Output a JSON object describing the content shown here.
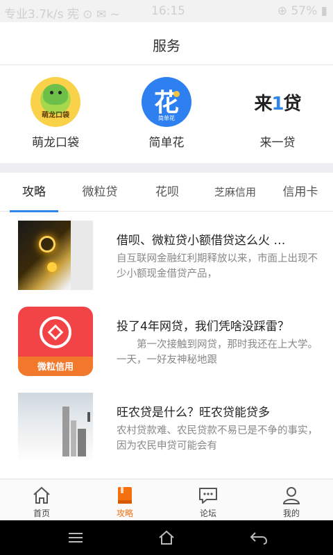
{
  "status_bar": {
    "left_text": "专业3.7k/s 宪 ⊙ ✉ ~",
    "time": "16:15",
    "right_text": "⊕ 57% ▮"
  },
  "header": {
    "title": "服务"
  },
  "services": [
    {
      "label": "萌龙口袋",
      "logo_text": "萌龙口袋",
      "icon": "menglong-logo"
    },
    {
      "label": "简单花",
      "logo_text": "花",
      "logo_subtext": "简单花",
      "icon": "jiandanhua-logo"
    },
    {
      "label": "来一贷",
      "logo_text_a": "来",
      "logo_text_b": "1",
      "logo_text_c": "贷",
      "icon": "laiyidai-logo"
    }
  ],
  "tabs": [
    {
      "label": "攻略",
      "active": true
    },
    {
      "label": "微粒贷",
      "active": false
    },
    {
      "label": "花呗",
      "active": false
    },
    {
      "label": "芝麻信用",
      "active": false
    },
    {
      "label": "信用卡",
      "active": false
    }
  ],
  "articles": [
    {
      "title": "借呗、微粒贷小额借贷这么火 …",
      "desc": "自互联网金融红利期释放以来，市面上出现不少小额现金借贷产品，",
      "thumb": "finance-hand-image"
    },
    {
      "title": "投了4年网贷，我们凭啥没踩雷？",
      "desc": "　　第一次接触到网贷，那时我还在上大学。一天，一好友神秘地跟",
      "thumb": "weili-credit-image",
      "thumb_text": "微粒信用"
    },
    {
      "title": "旺农贷是什么？旺农贷能贷多",
      "desc": "农村贷款难、农民贷款不易已是不争的事实，因为农民申贷可能会有",
      "thumb": "city-skyline-image"
    }
  ],
  "bottom_nav": [
    {
      "label": "首页",
      "icon": "home-icon",
      "active": false
    },
    {
      "label": "攻略",
      "icon": "book-icon",
      "active": true
    },
    {
      "label": "论坛",
      "icon": "chat-icon",
      "active": false
    },
    {
      "label": "我的",
      "icon": "user-icon",
      "active": false
    }
  ],
  "colors": {
    "accent_blue": "#2f86e8",
    "active_orange": "#f5700e",
    "muted_text": "#888888"
  }
}
